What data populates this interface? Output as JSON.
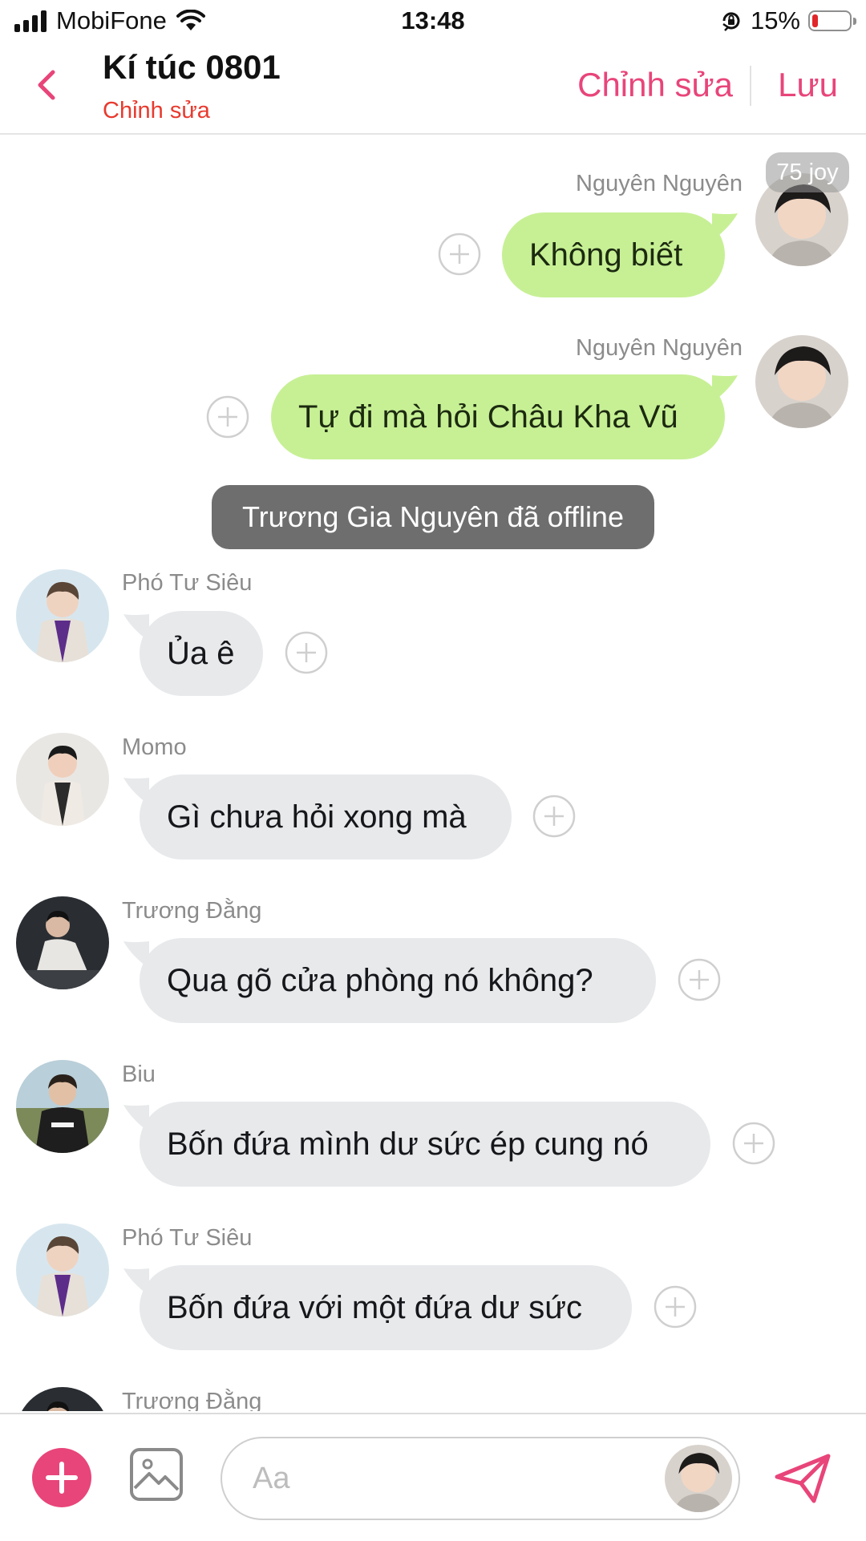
{
  "status_bar": {
    "carrier": "MobiFone",
    "time": "13:48",
    "battery": "15%",
    "battery_level": 0.15
  },
  "header": {
    "title": "Kí túc 0801",
    "subtitle": "Chỉnh sửa",
    "edit_label": "Chỉnh sửa",
    "save_label": "Lưu"
  },
  "badge": {
    "text": "75 joy"
  },
  "messages": [
    {
      "sender": "Nguyên Nguyên",
      "text": "Không biết",
      "direction": "out"
    },
    {
      "sender": "Nguyên Nguyên",
      "text": "Tự đi mà hỏi Châu Kha Vũ",
      "direction": "out"
    },
    {
      "system": "Trương Gia Nguyên đã offline"
    },
    {
      "sender": "Phó Tư Siêu",
      "text": "Ủa ê",
      "direction": "in"
    },
    {
      "sender": "Momo",
      "text": "Gì chưa hỏi xong mà",
      "direction": "in"
    },
    {
      "sender": "Trương Đằng",
      "text": "Qua gõ cửa phòng nó không?",
      "direction": "in"
    },
    {
      "sender": "Biu",
      "text": "Bốn đứa mình dư sức ép cung nó",
      "direction": "in"
    },
    {
      "sender": "Phó Tư Siêu",
      "text": "Bốn đứa với một đứa dư sức",
      "direction": "in"
    },
    {
      "sender": "Trương Đằng",
      "direction": "in"
    }
  ],
  "composer": {
    "placeholder": "Aa"
  },
  "colors": {
    "accent": "#e8457a",
    "outgoing_bubble": "#c7f095",
    "incoming_bubble": "#e7e9eb",
    "system_pill": "#6e6e6e",
    "subtitle": "#e83a2e"
  },
  "icons": [
    "back-chevron-icon",
    "wifi-icon",
    "orientation-lock-icon",
    "battery-icon",
    "add-reaction-icon",
    "plus-icon",
    "image-icon",
    "send-icon"
  ]
}
